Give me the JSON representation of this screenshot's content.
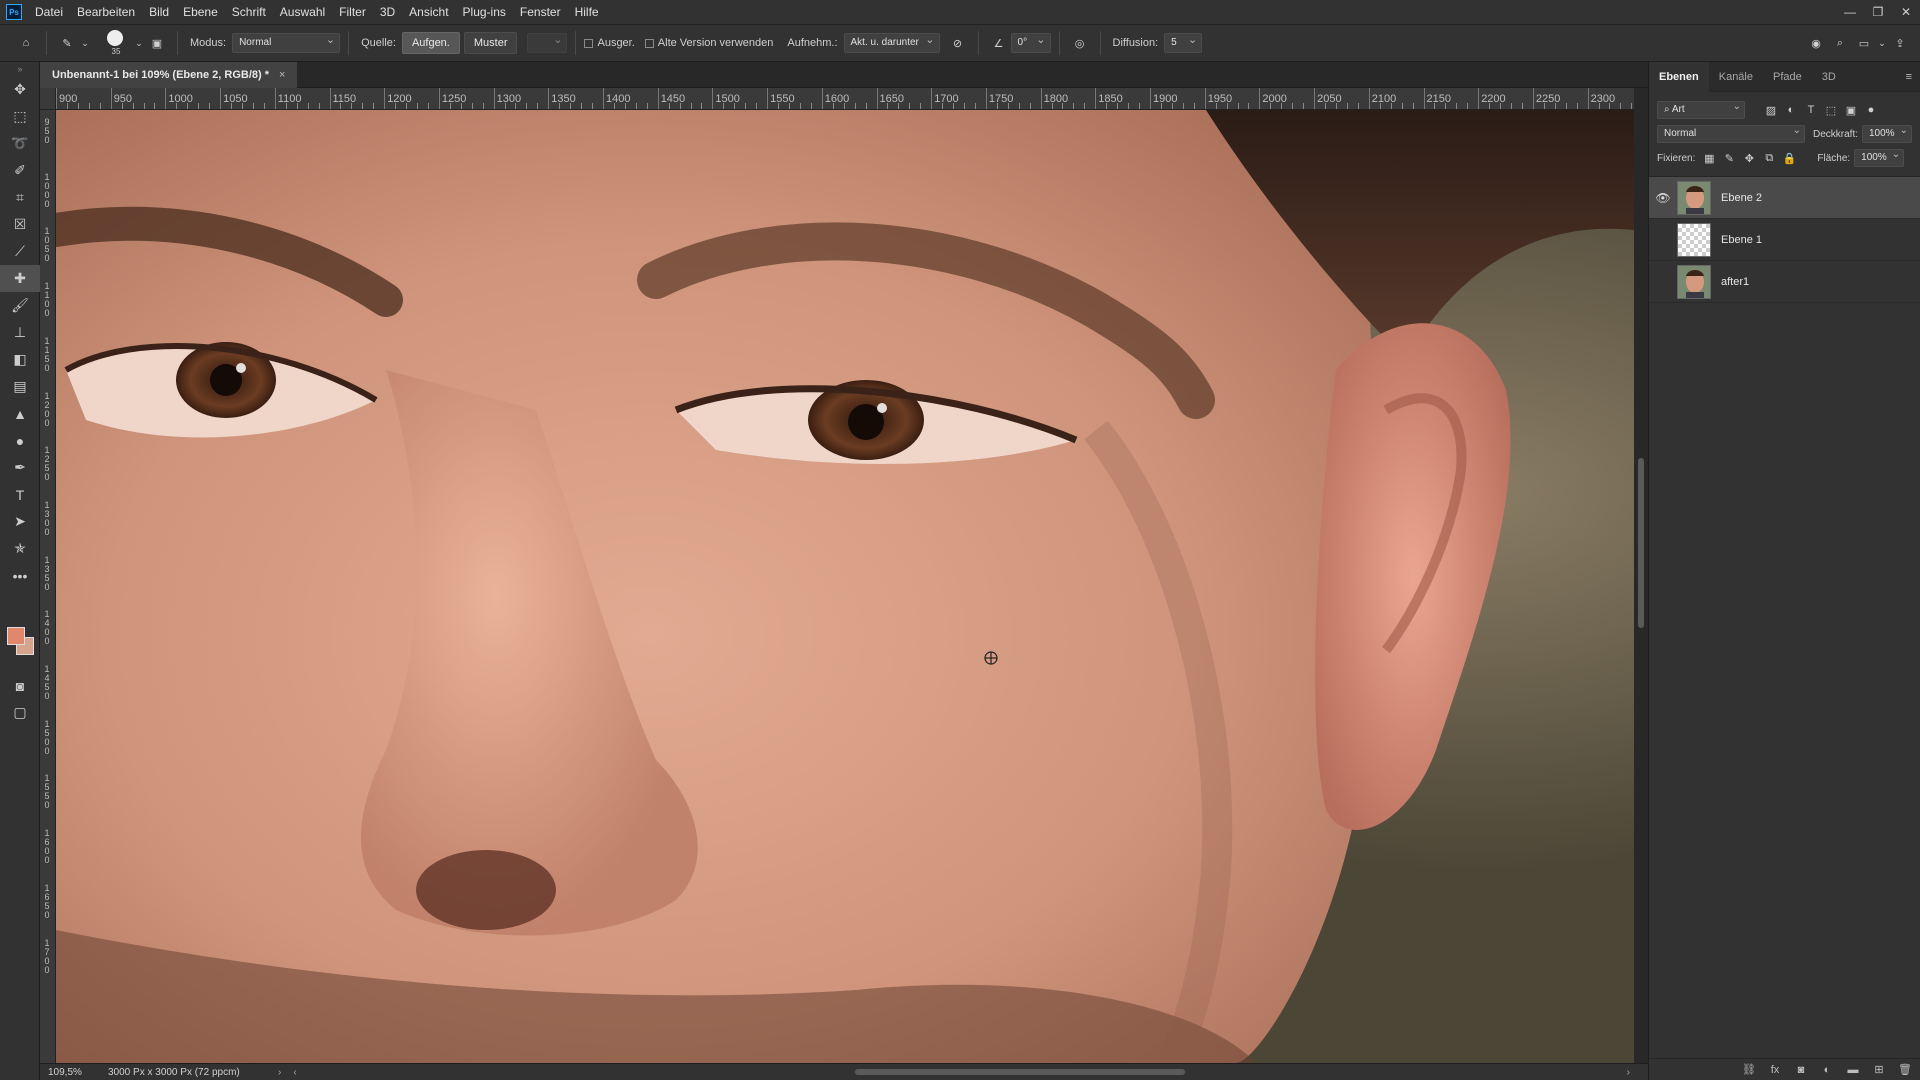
{
  "app": {
    "logo": "Ps",
    "menu": [
      "Datei",
      "Bearbeiten",
      "Bild",
      "Ebene",
      "Schrift",
      "Auswahl",
      "Filter",
      "3D",
      "Ansicht",
      "Plug-ins",
      "Fenster",
      "Hilfe"
    ],
    "window_controls": [
      "minimize-icon",
      "restore-icon",
      "close-icon"
    ]
  },
  "options": {
    "brush_size": "35",
    "modus_label": "Modus:",
    "modus_value": "Normal",
    "quelle_label": "Quelle:",
    "quelle_sample": "Aufgen.",
    "quelle_pattern": "Muster",
    "aligned_label": "Ausger.",
    "legacy_label": "Alte Version verwenden",
    "sample_label": "Aufnehm.:",
    "sample_value": "Akt. u. darunter",
    "angle_value": "0°",
    "diffusion_label": "Diffusion:",
    "diffusion_value": "5"
  },
  "document": {
    "tab_title": "Unbenannt-1 bei 109% (Ebene 2, RGB/8) *",
    "close": "×"
  },
  "ruler": {
    "h_labels": [
      "900",
      "950",
      "1000",
      "1050",
      "1100",
      "1150",
      "1200",
      "1250",
      "1300",
      "1350",
      "1400",
      "1450",
      "1500",
      "1550",
      "1600",
      "1650",
      "1700",
      "1750",
      "1800",
      "1850",
      "1900",
      "1950",
      "2000",
      "2050",
      "2100",
      "2150",
      "2200",
      "2250",
      "2300"
    ],
    "v_labels": [
      "950",
      "1000",
      "1050",
      "1100",
      "1150",
      "1200",
      "1250",
      "1300",
      "1350",
      "1400",
      "1450",
      "1500",
      "1550",
      "1600",
      "1650",
      "1700"
    ]
  },
  "status": {
    "zoom": "109,5%",
    "doc_info": "3000 Px x 3000 Px (72 ppcm)"
  },
  "panel": {
    "tabs": [
      "Ebenen",
      "Kanäle",
      "Pfade",
      "3D"
    ],
    "filter_value": "Art",
    "blend_mode": "Normal",
    "opacity_label": "Deckkraft:",
    "opacity_value": "100%",
    "lock_label": "Fixieren:",
    "fill_label": "Fläche:",
    "fill_value": "100%",
    "layers": [
      {
        "name": "Ebene 2",
        "visible": true,
        "selected": true
      },
      {
        "name": "Ebene 1",
        "visible": false,
        "selected": false
      },
      {
        "name": "after1",
        "visible": false,
        "selected": false
      }
    ]
  },
  "colors": {
    "foreground": "#e0876c",
    "background": "#d9a48c",
    "accent": "#31a8ff"
  }
}
